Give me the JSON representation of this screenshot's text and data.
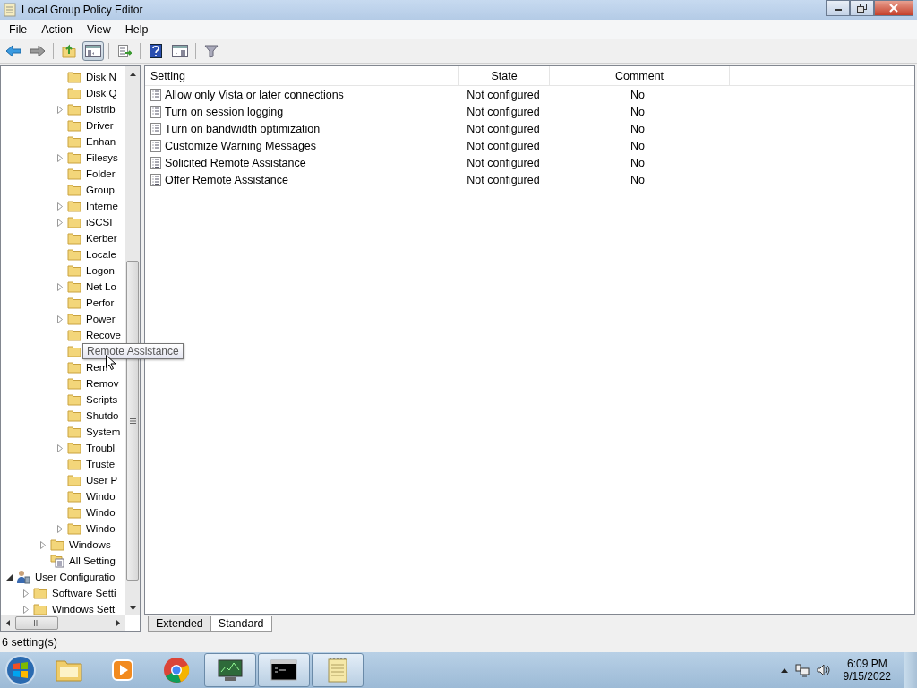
{
  "window": {
    "title": "Local Group Policy Editor"
  },
  "menu": [
    "File",
    "Action",
    "View",
    "Help"
  ],
  "toolbar": [
    {
      "kind": "back",
      "pressed": false
    },
    {
      "kind": "forward",
      "pressed": false
    },
    {
      "kind": "sep"
    },
    {
      "kind": "up",
      "pressed": false
    },
    {
      "kind": "tree",
      "pressed": true
    },
    {
      "kind": "sep"
    },
    {
      "kind": "export",
      "pressed": false
    },
    {
      "kind": "sep"
    },
    {
      "kind": "help",
      "pressed": false
    },
    {
      "kind": "pane",
      "pressed": false
    },
    {
      "kind": "sep"
    },
    {
      "kind": "filter",
      "pressed": false
    }
  ],
  "tree": [
    {
      "children": [
        {
          "children": [
            {
              "children": [
                {
                  "label": "Disk N",
                  "kind": "folder",
                  "expandable": false
                },
                {
                  "label": "Disk Q",
                  "kind": "folder",
                  "expandable": false
                },
                {
                  "label": "Distrib",
                  "kind": "folder",
                  "expandable": true,
                  "expanded": false
                },
                {
                  "label": "Driver",
                  "kind": "folder",
                  "expandable": false
                },
                {
                  "label": "Enhan",
                  "kind": "folder",
                  "expandable": false
                },
                {
                  "label": "Filesys",
                  "kind": "folder",
                  "expandable": true,
                  "expanded": false
                },
                {
                  "label": "Folder",
                  "kind": "folder",
                  "expandable": false
                },
                {
                  "label": "Group",
                  "kind": "folder",
                  "expandable": false
                },
                {
                  "label": "Interne",
                  "kind": "folder",
                  "expandable": true,
                  "expanded": false
                },
                {
                  "label": "iSCSI",
                  "kind": "folder",
                  "expandable": true,
                  "expanded": false
                },
                {
                  "label": "Kerber",
                  "kind": "folder",
                  "expandable": false
                },
                {
                  "label": "Locale",
                  "kind": "folder",
                  "expandable": false
                },
                {
                  "label": "Logon",
                  "kind": "folder",
                  "expandable": false
                },
                {
                  "label": "Net Lo",
                  "kind": "folder",
                  "expandable": true,
                  "expanded": false
                },
                {
                  "label": "Perfor",
                  "kind": "folder",
                  "expandable": false
                },
                {
                  "label": "Power",
                  "kind": "folder",
                  "expandable": true,
                  "expanded": false
                },
                {
                  "label": "Recove",
                  "kind": "folder",
                  "expandable": false
                },
                {
                  "tooltip": "Remote Assistance",
                  "kind": "folder",
                  "expandable": false
                },
                {
                  "label": "Rem",
                  "kind": "folder",
                  "expandable": false
                },
                {
                  "label": "Remov",
                  "kind": "folder",
                  "expandable": false
                },
                {
                  "label": "Scripts",
                  "kind": "folder",
                  "expandable": false
                },
                {
                  "label": "Shutdo",
                  "kind": "folder",
                  "expandable": false
                },
                {
                  "label": "System",
                  "kind": "folder",
                  "expandable": false
                },
                {
                  "label": "Troubl",
                  "kind": "folder",
                  "expandable": true,
                  "expanded": false
                },
                {
                  "label": "Truste",
                  "kind": "folder",
                  "expandable": false
                },
                {
                  "label": "User P",
                  "kind": "folder",
                  "expandable": false
                },
                {
                  "label": "Windo",
                  "kind": "folder",
                  "expandable": false
                },
                {
                  "label": "Windo",
                  "kind": "folder",
                  "expandable": false
                },
                {
                  "label": "Windo",
                  "kind": "folder",
                  "expandable": true,
                  "expanded": false
                }
              ]
            },
            {
              "label": "Windows",
              "kind": "folder",
              "expandable": true,
              "expanded": false
            },
            {
              "label": "All Setting",
              "kind": "settings",
              "expandable": false
            }
          ]
        }
      ]
    },
    {
      "label": "User Configuratio",
      "kind": "user",
      "expandable": true,
      "expanded": true,
      "children": [
        {
          "label": "Software Setti",
          "kind": "folder",
          "expandable": true,
          "expanded": false
        },
        {
          "label": "Windows Sett",
          "kind": "folder",
          "expandable": true,
          "expanded": false
        }
      ]
    }
  ],
  "table": {
    "columns": [
      "Setting",
      "State",
      "Comment"
    ],
    "rows": [
      {
        "setting": "Allow only Vista or later connections",
        "state": "Not configured",
        "comment": "No"
      },
      {
        "setting": "Turn on session logging",
        "state": "Not configured",
        "comment": "No"
      },
      {
        "setting": "Turn on bandwidth optimization",
        "state": "Not configured",
        "comment": "No"
      },
      {
        "setting": "Customize Warning Messages",
        "state": "Not configured",
        "comment": "No"
      },
      {
        "setting": "Solicited Remote Assistance",
        "state": "Not configured",
        "comment": "No"
      },
      {
        "setting": "Offer Remote Assistance",
        "state": "Not configured",
        "comment": "No"
      }
    ]
  },
  "tabs": [
    {
      "label": "Extended",
      "selected": false
    },
    {
      "label": "Standard",
      "selected": true
    }
  ],
  "status_bar": "6 setting(s)",
  "taskbar": {
    "apps": [
      {
        "kind": "explorer",
        "active": false
      },
      {
        "kind": "media",
        "active": false
      },
      {
        "kind": "browser",
        "active": false
      },
      {
        "kind": "monitor",
        "active": true
      },
      {
        "kind": "terminal",
        "active": true
      },
      {
        "kind": "notepad",
        "active": true
      }
    ],
    "time": "6:09 PM",
    "date": "9/15/2022"
  }
}
